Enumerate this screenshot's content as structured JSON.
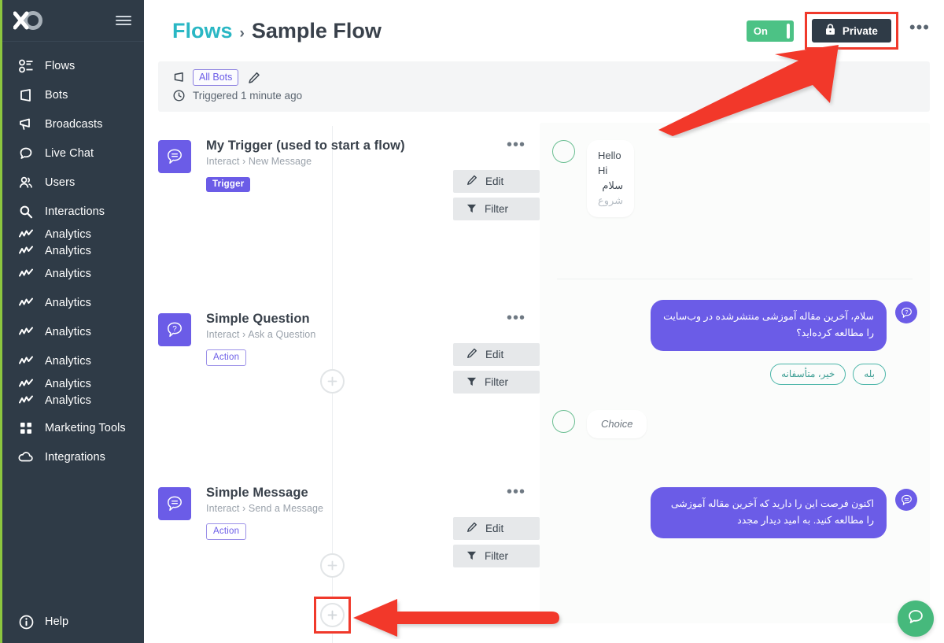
{
  "sidebar": {
    "logo_name": "brand-logo",
    "hamburger_name": "menu-toggle-icon",
    "items": [
      {
        "label": "Flows",
        "icon": "flows-icon"
      },
      {
        "label": "Bots",
        "icon": "bots-icon"
      },
      {
        "label": "Broadcasts",
        "icon": "broadcasts-icon"
      },
      {
        "label": "Live Chat",
        "icon": "live-chat-icon"
      },
      {
        "label": "Users",
        "icon": "users-icon"
      },
      {
        "label": "Interactions",
        "icon": "interactions-icon"
      },
      {
        "label": "Analytics",
        "icon": "analytics-icon"
      },
      {
        "label": "Analytics",
        "icon": "analytics-icon"
      },
      {
        "label": "Analytics",
        "icon": "analytics-icon"
      },
      {
        "label": "Analytics",
        "icon": "analytics-icon"
      },
      {
        "label": "Analytics",
        "icon": "analytics-icon"
      },
      {
        "label": "Analytics",
        "icon": "analytics-icon"
      },
      {
        "label": "Analytics",
        "icon": "analytics-icon"
      },
      {
        "label": "Analytics",
        "icon": "analytics-icon"
      },
      {
        "label": "Marketing Tools",
        "icon": "marketing-tools-icon"
      },
      {
        "label": "Integrations",
        "icon": "integrations-icon"
      }
    ],
    "help_label": "Help",
    "bg_color": "#2f3b47"
  },
  "header": {
    "breadcrumb_root": "Flows",
    "breadcrumb_separator": "›",
    "breadcrumb_current": "Sample Flow",
    "toggle_label": "On",
    "toggle_color": "#4cc285",
    "private_label": "Private",
    "private_icon": "lock-icon",
    "kebab_label": "•••",
    "highlight_color": "#f0392b"
  },
  "info_bar": {
    "bot_scope_badge": "All Bots",
    "bot_icon": "bot-flag-icon",
    "edit_icon": "pencil-icon",
    "clock_icon": "clock-icon",
    "triggered_text": "Triggered 1 minute ago"
  },
  "flow": {
    "nodes": [
      {
        "title": "My Trigger (used to start a flow)",
        "subtitle": "Interact › New Message",
        "badge": "Trigger",
        "badge_style": "filled",
        "icon": "message-bubble-icon",
        "edit_label": "Edit",
        "filter_label": "Filter",
        "kebab_label": "•••"
      },
      {
        "title": "Simple Question",
        "subtitle": "Interact › Ask a Question",
        "badge": "Action",
        "badge_style": "outline",
        "icon": "question-bubble-icon",
        "edit_label": "Edit",
        "filter_label": "Filter",
        "kebab_label": "•••"
      },
      {
        "title": "Simple Message",
        "subtitle": "Interact › Send a Message",
        "badge": "Action",
        "badge_style": "outline",
        "icon": "message-bubble-icon",
        "edit_label": "Edit",
        "filter_label": "Filter",
        "kebab_label": "•••"
      }
    ],
    "add_step_label": "+",
    "node_accent": "#6b5ce7"
  },
  "chat_preview": {
    "incoming_1": {
      "lines": [
        "Hello",
        "Hi",
        "سلام",
        "شروع"
      ]
    },
    "outgoing_1": {
      "text": "سلام، آخرین مقاله آموزشی منتشرشده در وب‌سایت را مطالعه کرده‌اید؟",
      "icon": "question-bubble-icon"
    },
    "quick_replies": [
      "خیر، متأسفانه",
      "بله"
    ],
    "incoming_2": {
      "lines": [
        "Choice"
      ]
    },
    "outgoing_2": {
      "text": "اکنون فرصت این را دارید که آخرین مقاله آموزشی را مطالعه کنید. به امید دیدار مجدد",
      "icon": "message-bubble-icon"
    },
    "widget_icon": "chat-bubble-icon",
    "widget_color": "#46b97c"
  }
}
